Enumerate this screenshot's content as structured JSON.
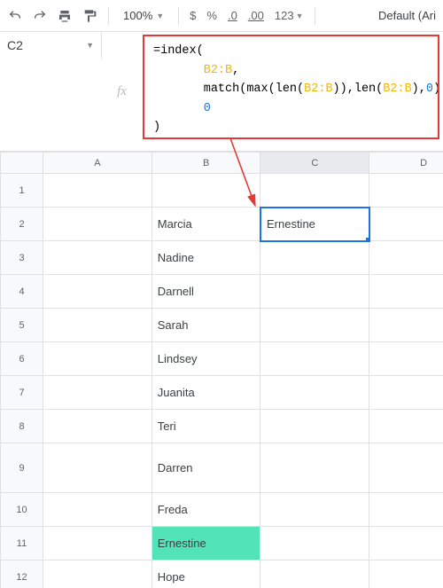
{
  "toolbar": {
    "zoom": "100%",
    "fmt": {
      "currency": "$",
      "percent": "%",
      "dec_dec": ".0",
      "dec_inc": ".00",
      "more": "123"
    },
    "font": "Default (Ari"
  },
  "namebox": "C2",
  "fx_label": "fx",
  "formula": {
    "l1a": "=index(",
    "l2_ref": "B2:B",
    "l2_tail": ",",
    "l3a": "match(max(len(",
    "l3_ref1": "B2:B",
    "l3b": ")),len(",
    "l3_ref2": "B2:B",
    "l3c": "),",
    "l3_num": "0",
    "l3d": "),",
    "l4_num": "0",
    "l5": ")"
  },
  "cols": {
    "a": "A",
    "b": "B",
    "c": "C",
    "d": "D"
  },
  "rows": {
    "1": "1",
    "2": "2",
    "3": "3",
    "4": "4",
    "5": "5",
    "6": "6",
    "7": "7",
    "8": "8",
    "9": "9",
    "10": "10",
    "11": "11",
    "12": "12"
  },
  "cells": {
    "b2": "Marcia",
    "b3": "Nadine",
    "b4": "Darnell",
    "b5": "Sarah",
    "b6": "Lindsey",
    "b7": "Juanita",
    "b8": "Teri",
    "b9": "Darren",
    "b10": "Freda",
    "b11": "Ernestine",
    "b12": "Hope",
    "c2": "Ernestine"
  }
}
